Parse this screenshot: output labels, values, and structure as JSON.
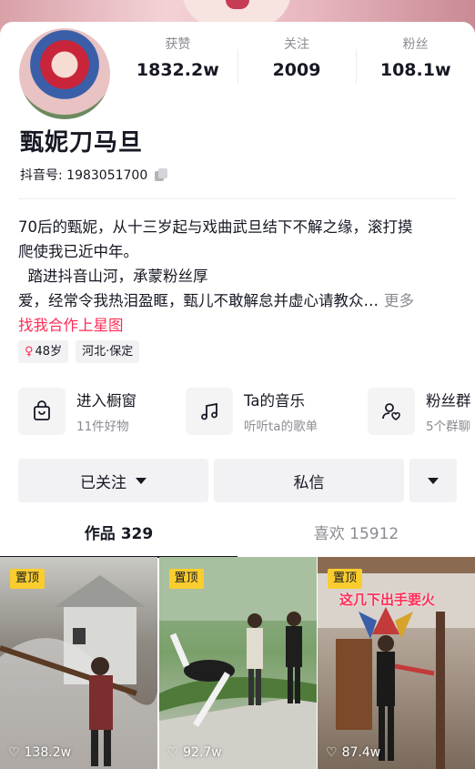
{
  "profile": {
    "name": "甄妮刀马旦",
    "douyin_id": "抖音号: 1983051700"
  },
  "stats": [
    {
      "label": "获赞",
      "value": "1832.2w"
    },
    {
      "label": "关注",
      "value": "2009"
    },
    {
      "label": "粉丝",
      "value": "108.1w"
    }
  ],
  "bio": {
    "line1": "70后的甄妮，从十三岁起与戏曲武旦结下不解之缘，滚打摸",
    "line2": "爬使我已近中年。",
    "line3": "  踏进抖音山河，承蒙粉丝厚",
    "line4": "爱，经常令我热泪盈眶，甄儿不敢解怠并虚心请教众…",
    "more": "更多",
    "link": "找我合作上星图"
  },
  "tags": [
    {
      "icon": "female-icon",
      "text": "48岁"
    },
    {
      "text": "河北·保定"
    }
  ],
  "features": [
    {
      "icon": "shopping-bag-icon",
      "title": "进入橱窗",
      "subtitle": "11件好物"
    },
    {
      "icon": "music-note-icon",
      "title": "Ta的音乐",
      "subtitle": "听听ta的歌单"
    },
    {
      "icon": "fan-group-icon",
      "title": "粉丝群",
      "subtitle": "5个群聊"
    }
  ],
  "buttons": {
    "followed": "已关注",
    "message": "私信"
  },
  "tabs": [
    {
      "label": "作品 329",
      "active": true
    },
    {
      "label": "喜欢 15912",
      "active": false
    }
  ],
  "videos": [
    {
      "pinned": "置顶",
      "likes": "138.2w"
    },
    {
      "pinned": "置顶",
      "likes": "92.7w"
    },
    {
      "pinned": "置顶",
      "likes": "87.4w",
      "title": "这几下出手要火"
    }
  ],
  "colors": {
    "accent": "#fe2c55",
    "pin_badge": "#facd2e"
  }
}
